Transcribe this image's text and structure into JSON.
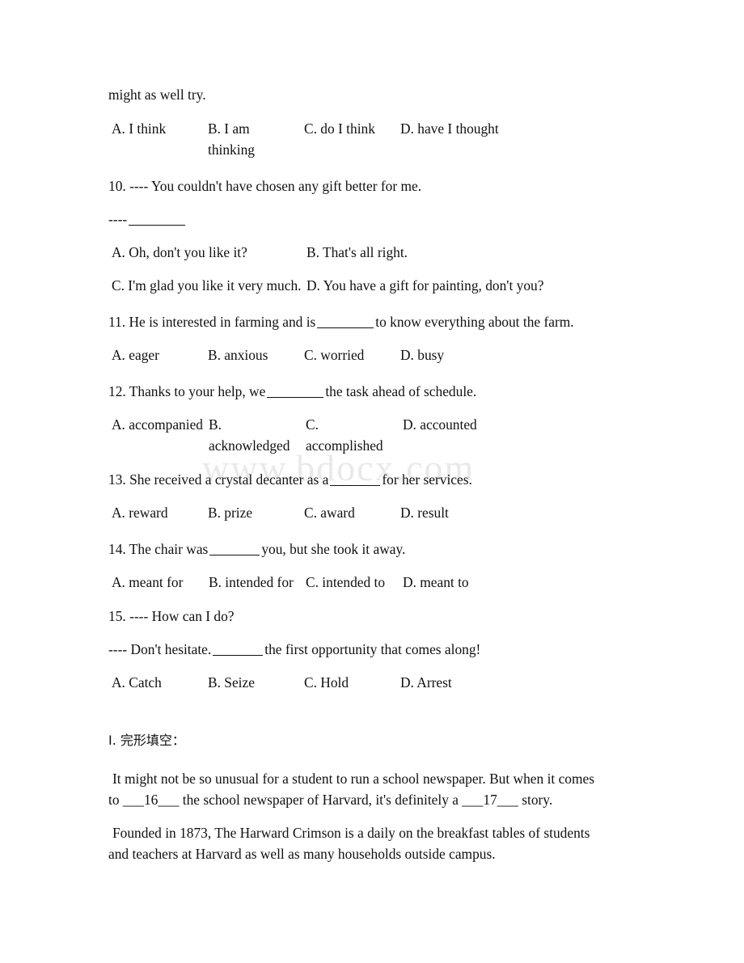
{
  "document": {
    "watermark": "www.bdocx.com",
    "top_fragment": "might as well try."
  },
  "questions": [
    {
      "id": "q9-options",
      "options": [
        "A. I think",
        "B. I am thinking",
        "C. do I think",
        "D. have I thought"
      ]
    },
    {
      "id": "q10",
      "number": "10.",
      "stem_line1": "10. ---- You couldn't have chosen any gift better for me.",
      "stem_line2_prefix": "----",
      "options": [
        "A. Oh, don't you like it?",
        "B. That's all right.",
        "C. I'm glad you like it very much.",
        "D. You have a gift for painting, don't you?"
      ]
    },
    {
      "id": "q11",
      "stem_before": "11. He is interested in farming and is",
      "stem_after": "to know everything about the farm.",
      "options": [
        "A. eager",
        "B. anxious",
        "C. worried",
        "D. busy"
      ]
    },
    {
      "id": "q12",
      "stem_before": "12. Thanks to your help, we",
      "stem_after": "the task ahead of schedule.",
      "options": [
        "A. accompanied",
        "B. acknowledged",
        "C. accomplished",
        "D. accounted"
      ]
    },
    {
      "id": "q13",
      "stem_before": "13. She received a crystal decanter as a",
      "stem_after": "for her services.",
      "options": [
        "A. reward",
        "B. prize",
        "C. award",
        "D. result"
      ]
    },
    {
      "id": "q14",
      "stem_before": "14. The chair was",
      "stem_after": "you, but she took it away.",
      "options": [
        "A. meant for",
        "B. intended for",
        "C. intended to",
        "D. meant to"
      ]
    },
    {
      "id": "q15",
      "stem_line1": "15. ---- How can I do?",
      "stem_line2_before": "---- Don't hesitate.",
      "stem_line2_after": "the first opportunity that comes along!",
      "options": [
        "A. Catch",
        "B. Seize",
        "C. Hold",
        "D. Arrest"
      ]
    }
  ],
  "cloze": {
    "heading": "I. 完形填空：",
    "paragraph1": "It might not be so unusual for a student to run a school newspaper. But when it comes to ___16___ the school newspaper of Harvard, it's definitely a ___17___ story.",
    "paragraph2": "Founded in 1873, The Harward Crimson is a daily on the breakfast tables of students and teachers at Harvard as well as many households outside campus."
  }
}
